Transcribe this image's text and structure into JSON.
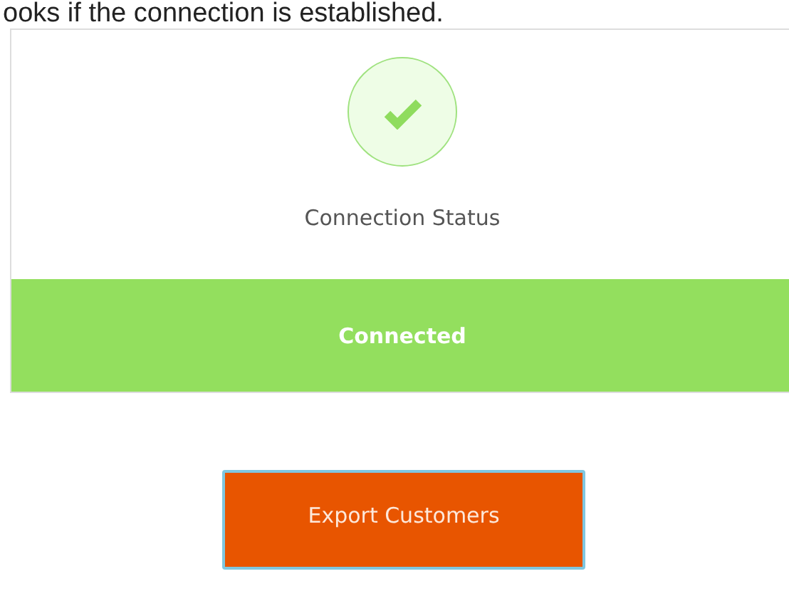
{
  "intro": "ooks if the connection is established.",
  "connection": {
    "label": "Connection Status",
    "kind": "success",
    "status": "Connected"
  },
  "button": {
    "label": "Export Customers"
  }
}
